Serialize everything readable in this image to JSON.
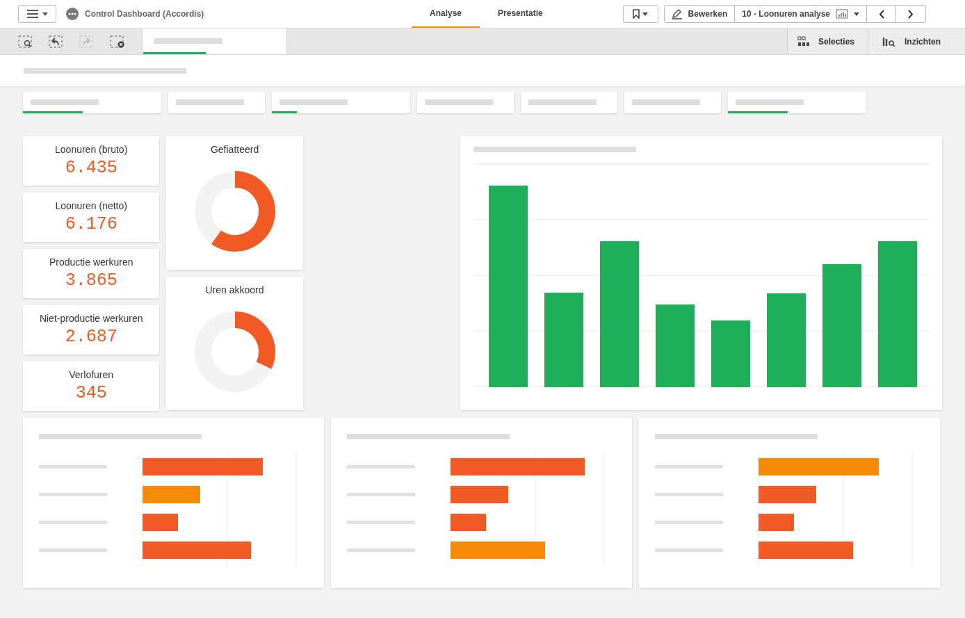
{
  "app_title": "Control Dashboard (Accordis)",
  "mode_tabs": [
    {
      "label": "Analyse",
      "selected": true
    },
    {
      "label": "Presentatie",
      "selected": false
    }
  ],
  "edit_button": "Bewerken",
  "sheet_name": "10 - Loonuren analyse",
  "selection_tab": {
    "level": 0.44
  },
  "side_buttons": [
    "Selecties",
    "Inzichten"
  ],
  "filters": [
    {
      "active": true,
      "level": 0.43
    },
    {
      "active": false
    },
    {
      "active": true,
      "level": 0.18
    },
    {
      "active": false
    },
    {
      "active": false
    },
    {
      "active": false
    },
    {
      "active": true,
      "level": 0.43
    }
  ],
  "kpis": [
    {
      "label": "Loonuren (bruto)",
      "value": "6.435"
    },
    {
      "label": "Loonuren (netto)",
      "value": "6.176"
    },
    {
      "label": "Productie werkuren",
      "value": "3.865"
    },
    {
      "label": "Niet-productie werkuren",
      "value": "2.687"
    },
    {
      "label": "Verlofuren",
      "value": "345"
    }
  ],
  "gauges": [
    {
      "title": "Gefiatteerd"
    },
    {
      "title": "Uren akkoord"
    }
  ]
}
